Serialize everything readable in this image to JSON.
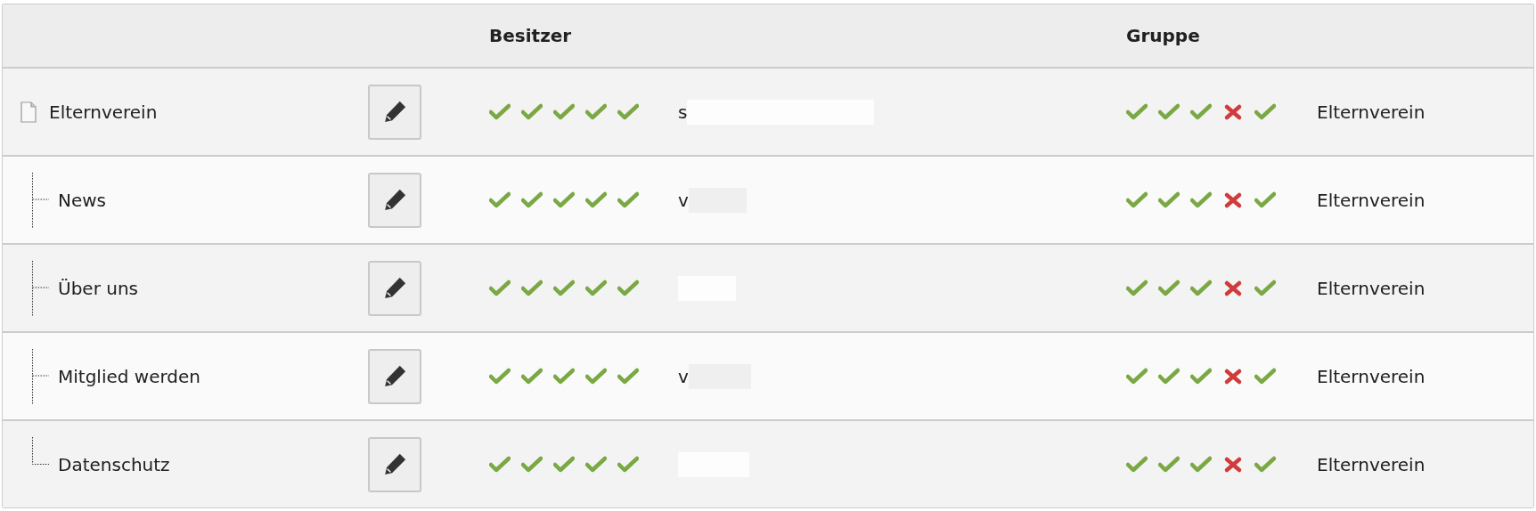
{
  "table": {
    "columns": [
      {
        "label": "Besitzer"
      },
      {
        "label": "Gruppe"
      }
    ],
    "tree": {
      "title": "Elternverein",
      "owner_permissions": [
        true,
        true,
        true,
        true,
        true
      ],
      "owner": "s",
      "group_permissions": [
        true,
        true,
        true,
        false,
        true
      ],
      "group": "Elternverein",
      "children": [
        {
          "title": "News",
          "owner_permissions": [
            true,
            true,
            true,
            true,
            true
          ],
          "owner": "v",
          "group_permissions": [
            true,
            true,
            true,
            false,
            true
          ],
          "group": "Elternverein"
        },
        {
          "title": "Über uns",
          "owner_permissions": [
            true,
            true,
            true,
            true,
            true
          ],
          "group_permissions": [
            true,
            true,
            true,
            false,
            true
          ],
          "group": "Elternverein"
        },
        {
          "title": "Mitglied werden",
          "owner_permissions": [
            true,
            true,
            true,
            true,
            true
          ],
          "owner": "v",
          "group_permissions": [
            true,
            true,
            true,
            false,
            true
          ],
          "group": "Elternverein"
        },
        {
          "title": "Datenschutz",
          "owner_permissions": [
            true,
            true,
            true,
            true,
            true
          ],
          "group_permissions": [
            true,
            true,
            true,
            false,
            true
          ],
          "group": "Elternverein"
        }
      ]
    }
  }
}
